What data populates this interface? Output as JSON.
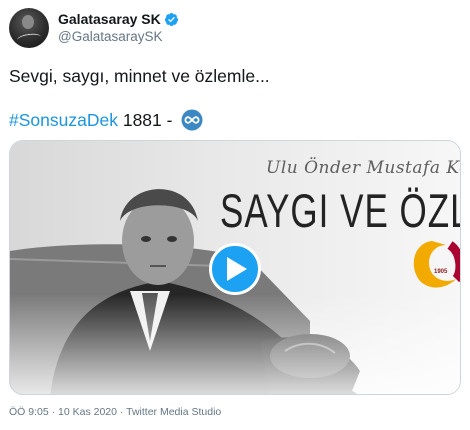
{
  "account": {
    "display_name": "Galatasaray SK",
    "handle": "@GalatasaraySK",
    "verified": true,
    "verified_icon": "verified-badge-icon",
    "verified_color": "#1da1f2"
  },
  "tweet": {
    "text": "Sevgi, saygı, minnet ve özlemle...",
    "hashtag": "#SonsuzaDek",
    "suffix": " 1881 - ",
    "emoji_icon": "infinity-icon",
    "link_color": "#1b95e0"
  },
  "media": {
    "script_text": "Ulu Önder Mustafa Kemal Atatürk",
    "title": "SAYGI VE ÖZLEMLE ANIYO",
    "logo_year": "1905",
    "play_icon": "play-icon",
    "play_color": "#1da1f2"
  },
  "meta": {
    "line": "ÖÖ 9:05 · 10 Kas 2020 · Twitter Media Studio"
  }
}
